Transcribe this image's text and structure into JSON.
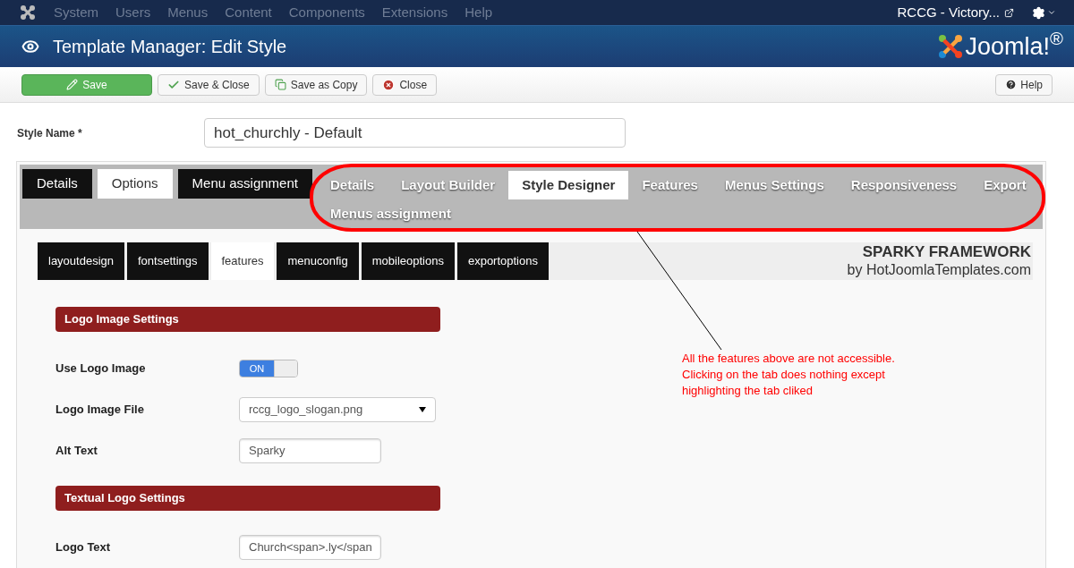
{
  "top_menu": {
    "items": [
      "System",
      "Users",
      "Menus",
      "Content",
      "Components",
      "Extensions",
      "Help"
    ],
    "site_link": "RCCG - Victory..."
  },
  "header": {
    "title": "Template Manager: Edit Style",
    "logo_text": "Joomla!$^{®}$"
  },
  "toolbar": {
    "buttons": [
      {
        "label": "Save",
        "kind": "primary"
      },
      {
        "label": "Save & Close",
        "kind": "check"
      },
      {
        "label": "Save as Copy",
        "kind": "copy"
      },
      {
        "label": "Close",
        "kind": "close"
      }
    ],
    "help": "Help"
  },
  "style_name": {
    "label": "Style Name *",
    "value": "hot_churchly - Default"
  },
  "main_tabs": [
    {
      "label": "Details",
      "selected": false
    },
    {
      "label": "Options",
      "selected": true
    },
    {
      "label": "Menu assignment",
      "selected": false
    }
  ],
  "designer_tabs": [
    {
      "label": "Details",
      "selected": false
    },
    {
      "label": "Layout Builder",
      "selected": false
    },
    {
      "label": "Style Designer",
      "selected": true
    },
    {
      "label": "Features",
      "selected": false
    },
    {
      "label": "Menus Settings",
      "selected": false
    },
    {
      "label": "Responsiveness",
      "selected": false
    },
    {
      "label": "Export",
      "selected": false
    },
    {
      "label": "Menus assignment",
      "selected": false
    }
  ],
  "sub_tabs": [
    {
      "label": "layoutdesign",
      "selected": false
    },
    {
      "label": "fontsettings",
      "selected": false
    },
    {
      "label": "features",
      "selected": true
    },
    {
      "label": "menuconfig",
      "selected": false
    },
    {
      "label": "mobileoptions",
      "selected": false
    },
    {
      "label": "exportoptions",
      "selected": false
    }
  ],
  "branding": {
    "title": "SPARKY FRAMEWORK",
    "byline": "by HotJoomlaTemplates.com"
  },
  "sections": [
    {
      "title": "Logo Image Settings",
      "fields": [
        {
          "kind": "toggle",
          "label": "Use Logo Image",
          "on": true,
          "on_text": "ON"
        },
        {
          "kind": "select",
          "label": "Logo Image File",
          "value": "rccg_logo_slogan.png"
        },
        {
          "kind": "text",
          "label": "Alt Text",
          "value": "Sparky"
        }
      ]
    },
    {
      "title": "Textual Logo Settings",
      "fields": [
        {
          "kind": "text",
          "label": "Logo Text",
          "value": "Church<span>.ly</span"
        }
      ]
    }
  ],
  "annotation": {
    "note": "All the features above are not accessible. Clicking on the tab does nothing except highlighting the tab cliked"
  }
}
